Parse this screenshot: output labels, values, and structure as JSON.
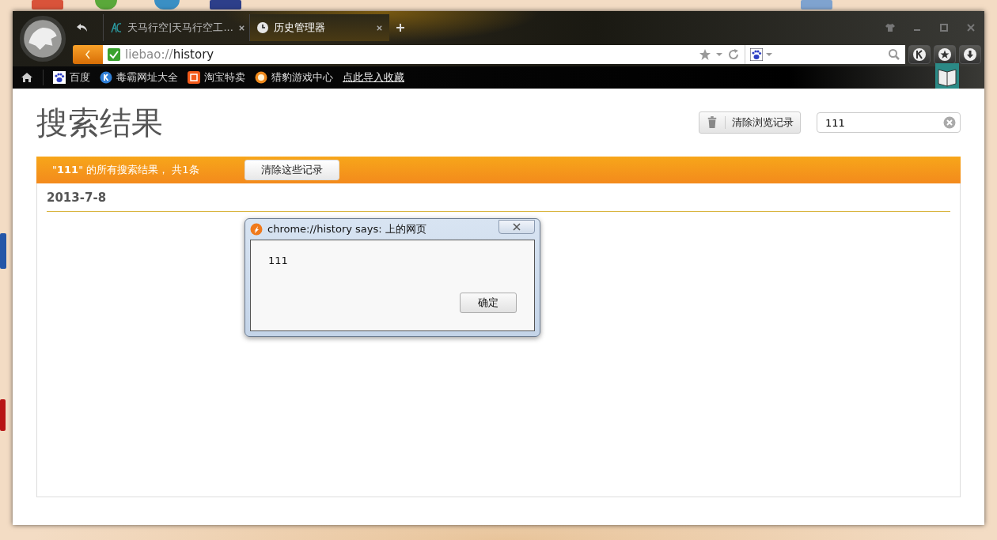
{
  "tabs": [
    {
      "title": "天马行空|天马行空工...",
      "selected": false,
      "kind": "site"
    },
    {
      "title": "历史管理器",
      "selected": true,
      "kind": "history"
    }
  ],
  "address_bar": {
    "url_scheme": "liebao://",
    "url_path": "history"
  },
  "bookmarks": [
    {
      "label": "百度",
      "kind": "paw"
    },
    {
      "label": "毒霸网址大全",
      "kind": "k"
    },
    {
      "label": "淘宝特卖",
      "kind": "tao"
    },
    {
      "label": "猎豹游戏中心",
      "kind": "game"
    },
    {
      "label": "点此导入收藏",
      "kind": "link"
    }
  ],
  "page": {
    "title": "搜索结果",
    "clear_history_button": "清除浏览记录",
    "search": {
      "value": "111"
    },
    "results_bar": {
      "summary": "\"**111**\" 的所有搜索结果， 共1条",
      "button": "清除这些记录"
    },
    "date": "2013-7-8"
  },
  "dialog": {
    "title": "chrome://history says: 上的网页",
    "message": "111",
    "ok_button": "确定"
  }
}
